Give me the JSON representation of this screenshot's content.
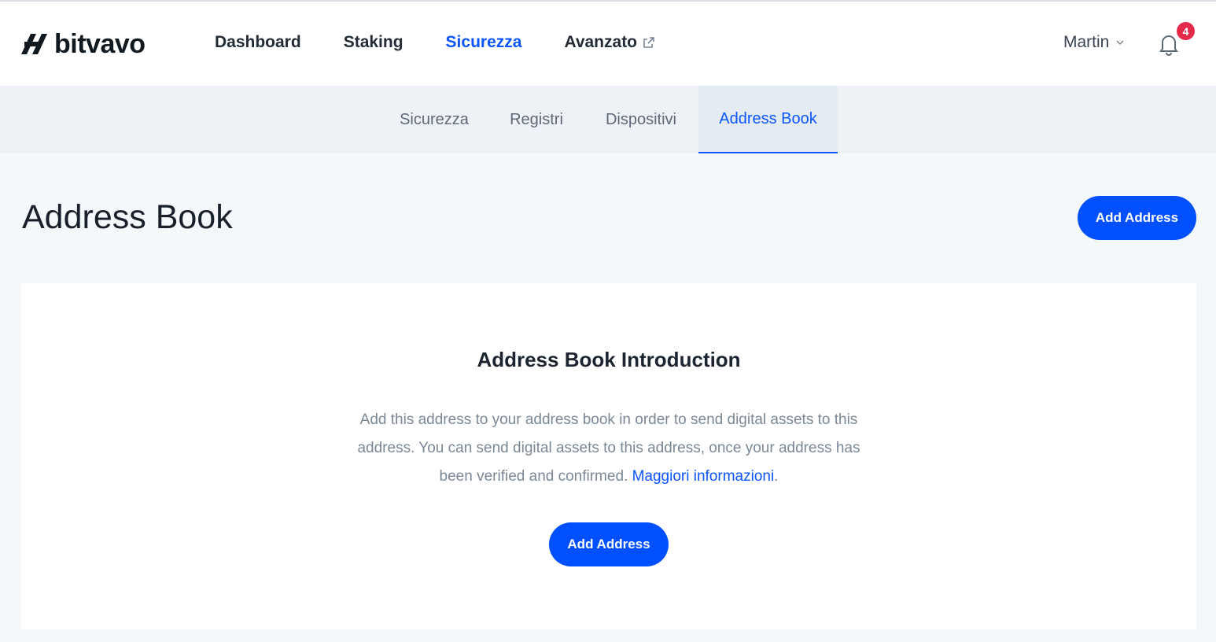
{
  "brand": {
    "name": "bitvavo"
  },
  "main_nav": [
    {
      "label": "Dashboard",
      "active": false
    },
    {
      "label": "Staking",
      "active": false
    },
    {
      "label": "Sicurezza",
      "active": true
    },
    {
      "label": "Avanzato",
      "active": false,
      "external": true
    }
  ],
  "user": {
    "name": "Martin"
  },
  "notifications": {
    "count": "4"
  },
  "sub_nav": [
    {
      "label": "Sicurezza",
      "active": false
    },
    {
      "label": "Registri",
      "active": false
    },
    {
      "label": "Dispositivi",
      "active": false
    },
    {
      "label": "Address Book",
      "active": true
    }
  ],
  "page": {
    "title": "Address Book",
    "add_button": "Add Address"
  },
  "card": {
    "title": "Address Book Introduction",
    "body_text": "Add this address to your address book in order to send digital assets to this address. You can send digital assets to this address, once your address has been verified and confirmed.",
    "link_text": "Maggiori informazioni",
    "link_suffix": ".",
    "button": "Add Address"
  },
  "colors": {
    "accent": "#0050ff",
    "active_link": "#0b55ff",
    "badge": "#e5294b",
    "page_bg": "#f5f8fb",
    "subnav_bg": "#eef2f7"
  },
  "icons": [
    "bitvavo-logo-icon",
    "external-link-icon",
    "chevron-down-icon",
    "bell-icon"
  ]
}
